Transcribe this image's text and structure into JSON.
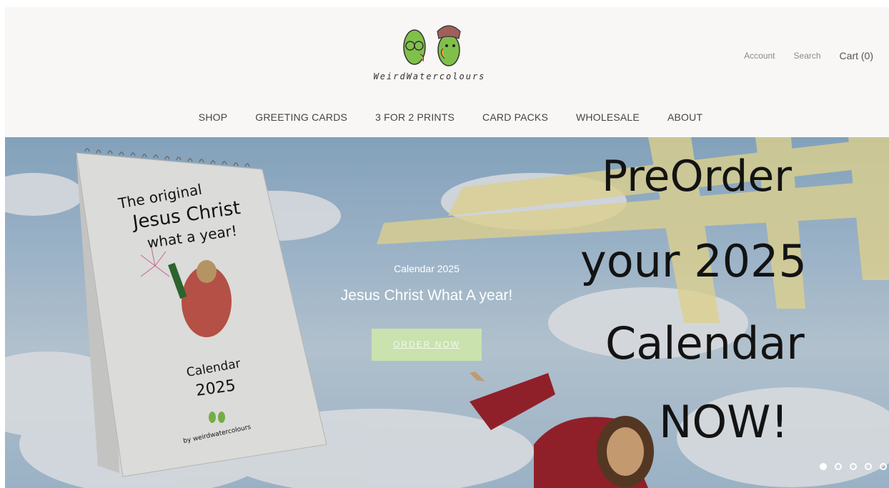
{
  "header": {
    "logo_text": "WeirdWatercolours",
    "account_label": "Account",
    "search_label": "Search",
    "cart_label": "Cart (0)"
  },
  "nav": {
    "items": [
      "SHOP",
      "GREETING CARDS",
      "3 FOR 2 PRINTS",
      "CARD PACKS",
      "WHOLESALE",
      "ABOUT"
    ]
  },
  "hero": {
    "subtitle": "Calendar 2025",
    "title": "Jesus Christ What A year!",
    "button_label": "ORDER NOW",
    "slides_count": 5,
    "active_slide": 1,
    "calendar_cover": {
      "line1": "The original",
      "line2": "Jesus Christ",
      "line3": "what a year!",
      "line4": "Calendar",
      "line5": "2025",
      "line6": "by weirdwatercolours"
    },
    "handwritten": {
      "line1": "PreOrder",
      "line2": "your 2025",
      "line3": "Calendar",
      "line4": "NOW!"
    }
  },
  "colors": {
    "header_bg": "#f8f7f5",
    "button_bg": "#c9e2ae",
    "bean_green": "#7fc04a"
  }
}
